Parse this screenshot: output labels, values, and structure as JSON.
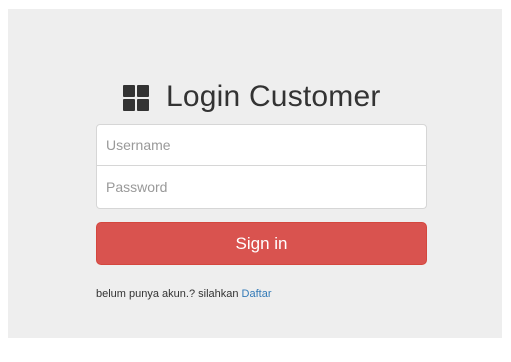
{
  "login": {
    "icon": "th-large-icon",
    "title": "Login Customer",
    "username_placeholder": "Username",
    "username_value": "",
    "password_placeholder": "Password",
    "password_value": "",
    "signin_label": "Sign in",
    "register_prompt": "belum punya akun.? silahkan",
    "register_link": "Daftar"
  },
  "colors": {
    "panel_background": "#eeeeee",
    "signin_button": "#d9534f",
    "link": "#337ab7"
  }
}
